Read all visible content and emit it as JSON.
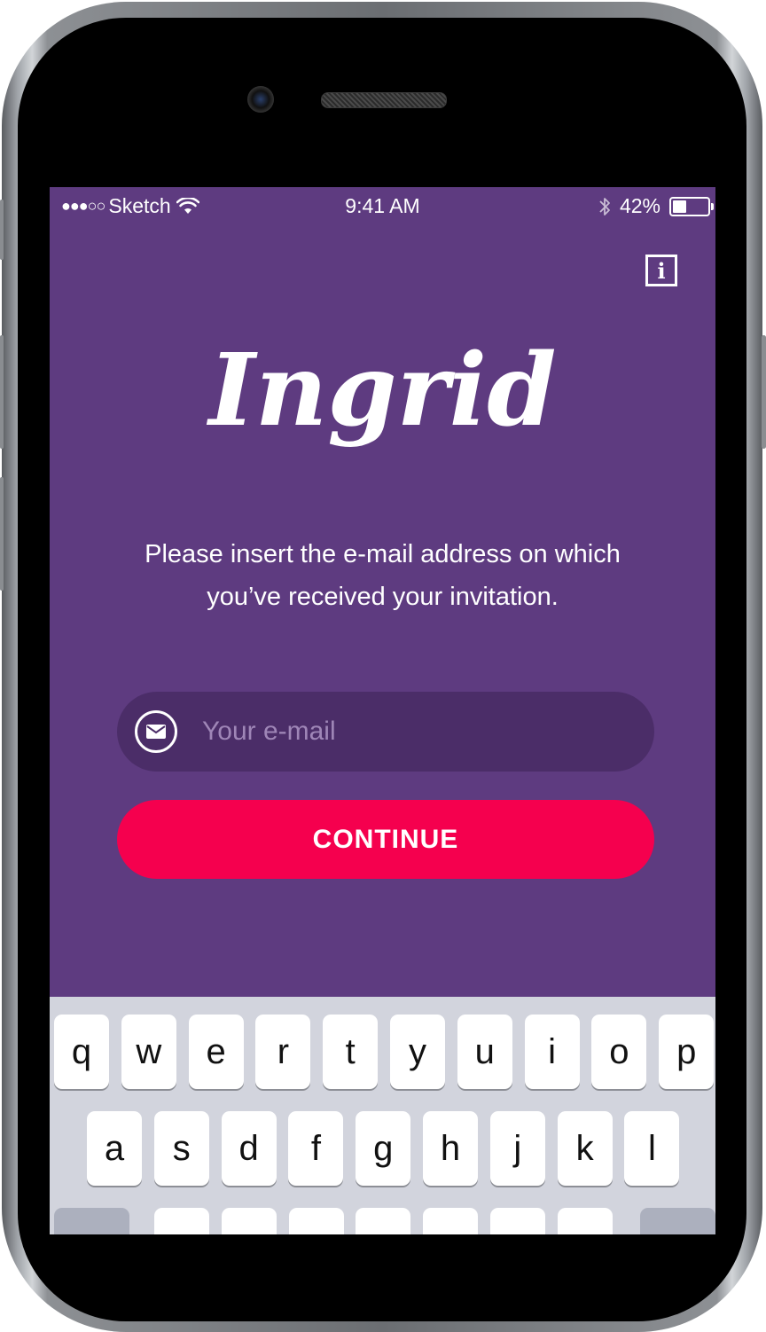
{
  "status_bar": {
    "carrier": "Sketch",
    "signal": "●●●○○",
    "time": "9:41 AM",
    "battery": "42%",
    "battery_level": 0.42
  },
  "header": {
    "info_icon": "i"
  },
  "logo": {
    "text": "Ingrid"
  },
  "instructions": {
    "line1": "Please insert the e-mail address on which",
    "line2": "you’ve received your invitation."
  },
  "email": {
    "placeholder": "Your e-mail",
    "value": ""
  },
  "continue_button": {
    "label": "CONTINUE"
  },
  "keyboard": {
    "row1": [
      "q",
      "w",
      "e",
      "r",
      "t",
      "y",
      "u",
      "i",
      "o",
      "p"
    ],
    "row2": [
      "a",
      "s",
      "d",
      "f",
      "g",
      "h",
      "j",
      "k",
      "l"
    ]
  },
  "colors": {
    "background": "#5e3b80",
    "field": "#4b2d68",
    "accent": "#f5004e"
  }
}
